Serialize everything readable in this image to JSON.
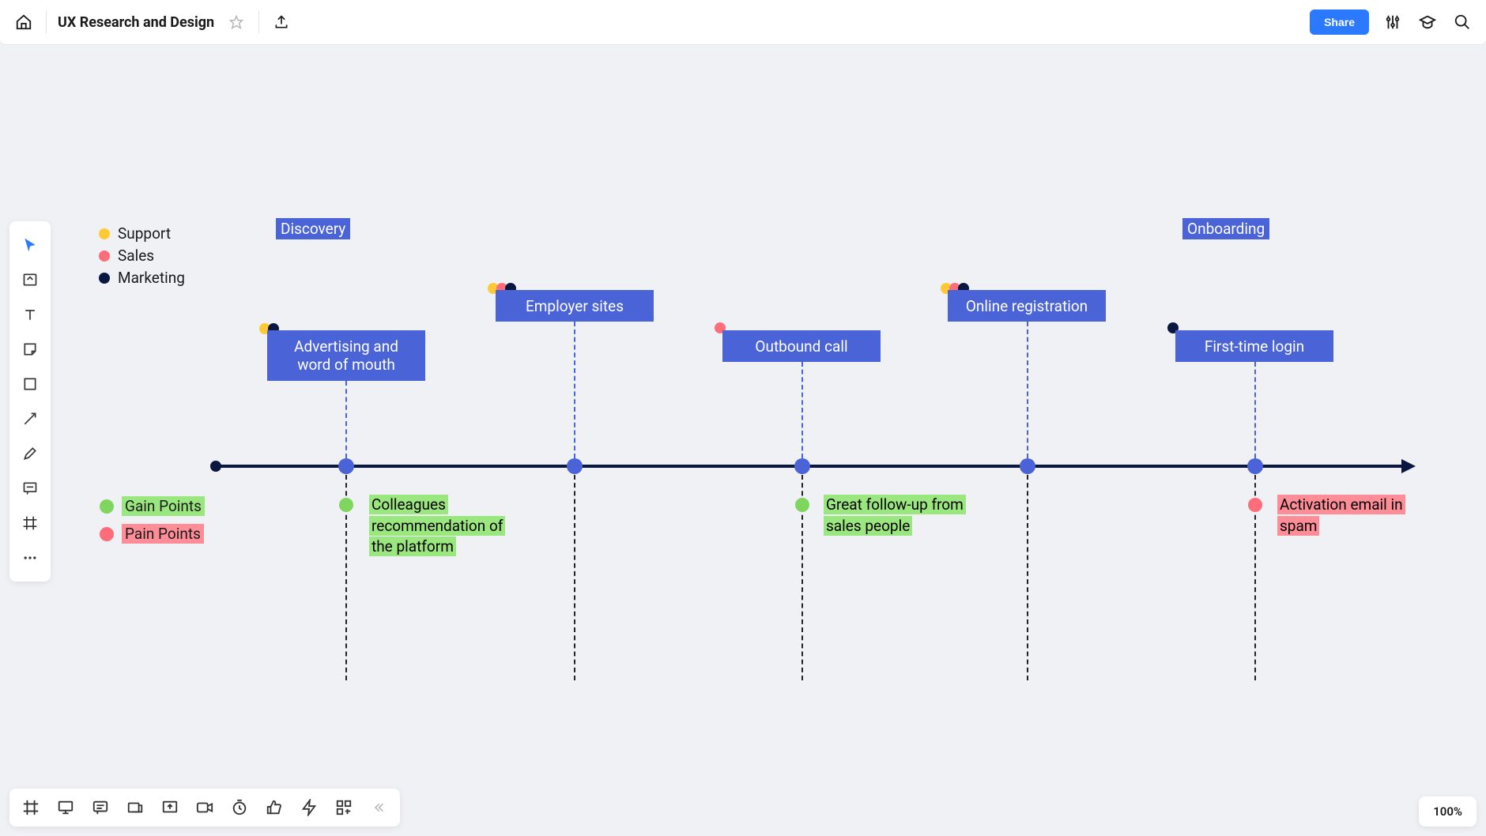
{
  "header": {
    "doc_title": "UX Research and Design",
    "share_label": "Share"
  },
  "zoom_level": "100%",
  "colors": {
    "support": "#ffc934",
    "sales": "#ff6d7a",
    "marketing": "#0a1740",
    "gain": "#7fd65f",
    "pain": "#ff6d7a",
    "stage_bg": "#4a63d6",
    "timeline": "#0a1740"
  },
  "legend_top": [
    {
      "color": "support",
      "label": "Support"
    },
    {
      "color": "sales",
      "label": "Sales"
    },
    {
      "color": "marketing",
      "label": "Marketing"
    }
  ],
  "legend_bottom": [
    {
      "color": "gain",
      "label": "Gain Points"
    },
    {
      "color": "pain",
      "label": "Pain Points"
    }
  ],
  "phases": [
    {
      "label": "Discovery"
    },
    {
      "label": "Onboarding"
    }
  ],
  "stages": [
    {
      "label": "Advertising and word of mouth",
      "dots": [
        "support",
        "marketing"
      ]
    },
    {
      "label": "Employer sites",
      "dots": [
        "support",
        "sales",
        "marketing"
      ]
    },
    {
      "label": "Outbound call",
      "dots": [
        "sales"
      ]
    },
    {
      "label": "Online registration",
      "dots": [
        "support",
        "sales",
        "marketing"
      ]
    },
    {
      "label": "First-time login",
      "dots": [
        "marketing"
      ]
    }
  ],
  "points": [
    {
      "stage": 0,
      "type": "gain",
      "text": "Colleagues recommendation of the platform"
    },
    {
      "stage": 2,
      "type": "gain",
      "text": "Great follow-up from sales people"
    },
    {
      "stage": 4,
      "type": "pain",
      "text": "Activation email in spam"
    }
  ]
}
